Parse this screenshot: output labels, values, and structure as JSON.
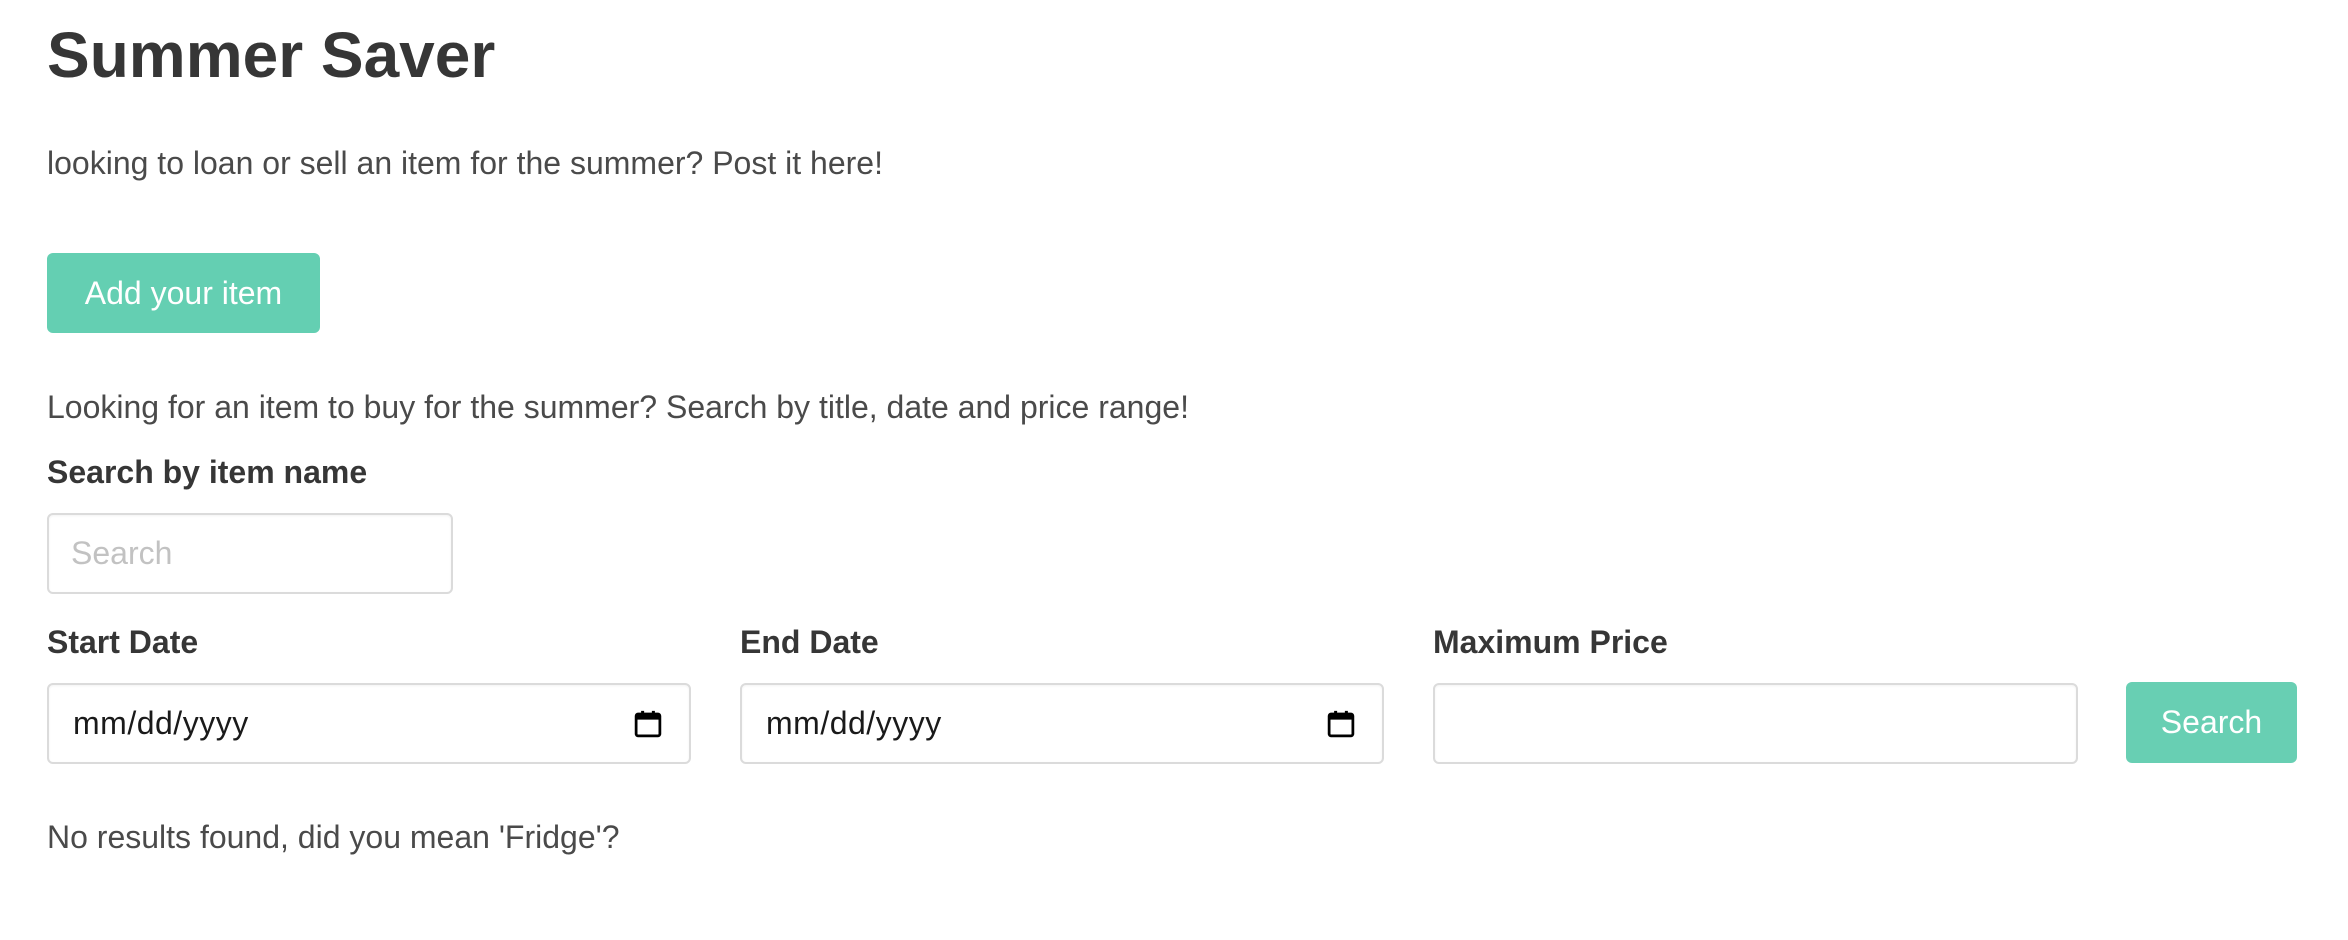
{
  "page": {
    "title": "Summer Saver",
    "intro": "looking to loan or sell an item for the summer? Post it here!",
    "add_button": "Add your item",
    "search_intro": "Looking for an item to buy for the summer? Search by title, date and price range!"
  },
  "search": {
    "name_label": "Search by item name",
    "name_placeholder": "Search",
    "name_value": "",
    "start_label": "Start Date",
    "start_value": "mm/dd/yyyy",
    "end_label": "End Date",
    "end_value": "mm/dd/yyyy",
    "max_price_label": "Maximum Price",
    "max_price_value": "",
    "button": "Search"
  },
  "results": {
    "message": "No results found, did you mean 'Fridge'?"
  },
  "icons": {
    "date_picker": "calendar-icon"
  },
  "colors": {
    "accent": "#64cfb2",
    "text": "#363636",
    "border": "#dbdbdb"
  }
}
